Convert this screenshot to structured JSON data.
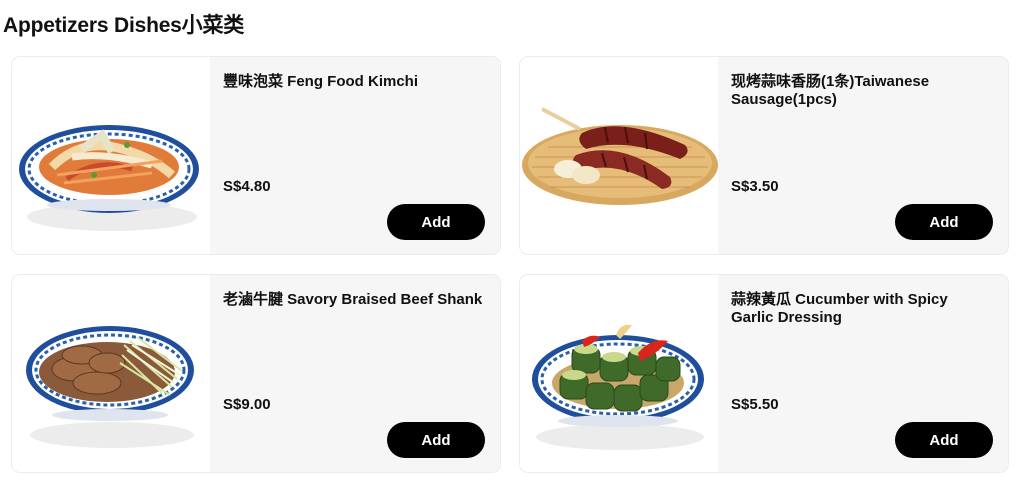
{
  "section": {
    "title": "Appetizers Dishes小菜类"
  },
  "items": [
    {
      "name": "豐味泡菜 Feng Food Kimchi",
      "price": "S$4.80",
      "add_label": "Add",
      "image": "kimchi-bowl-image"
    },
    {
      "name": "现烤蒜味香肠(1条)Taiwanese Sausage(1pcs)",
      "price": "S$3.50",
      "add_label": "Add",
      "image": "sausage-tray-image"
    },
    {
      "name": "老滷牛腱 Savory Braised Beef Shank",
      "price": "S$9.00",
      "add_label": "Add",
      "image": "beef-shank-bowl-image"
    },
    {
      "name": "蒜辣黃瓜 Cucumber with Spicy Garlic Dressing",
      "price": "S$5.50",
      "add_label": "Add",
      "image": "cucumber-bowl-image"
    }
  ]
}
